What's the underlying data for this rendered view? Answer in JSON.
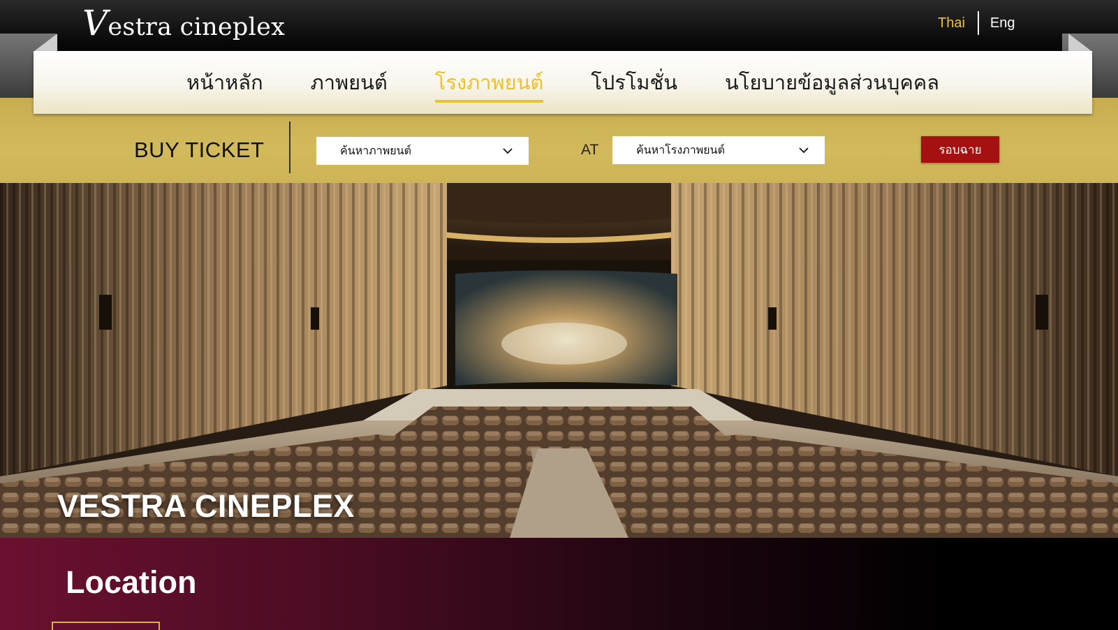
{
  "header": {
    "logo_initial": "V",
    "logo_rest": "estra cineplex",
    "lang_thai": "Thai",
    "lang_eng": "Eng"
  },
  "nav": {
    "items": [
      {
        "label": "หน้าหลัก",
        "active": false
      },
      {
        "label": "ภาพยนต์",
        "active": false
      },
      {
        "label": "โรงภาพยนต์",
        "active": true
      },
      {
        "label": "โปรโมชั่น",
        "active": false
      },
      {
        "label": "นโยบายข้อมูลส่วนบุคคล",
        "active": false
      }
    ]
  },
  "ticket_bar": {
    "label": "BUY TICKET",
    "movie_select_value": "ค้นหาภาพยนต์",
    "at_label": "AT",
    "cinema_select_value": "ค้นหาโรงภาพยนต์",
    "showtime_button": "รอบฉาย"
  },
  "hero": {
    "title": "VESTRA CINEPLEX"
  },
  "location": {
    "title": "Location"
  },
  "colors": {
    "accent_gold": "#efc128",
    "ticket_bar_gold": "#d2ba5c",
    "showtime_red": "#a51010",
    "location_maroon": "#6b1030"
  },
  "icons": {
    "dropdown": "chevron-down-icon"
  }
}
